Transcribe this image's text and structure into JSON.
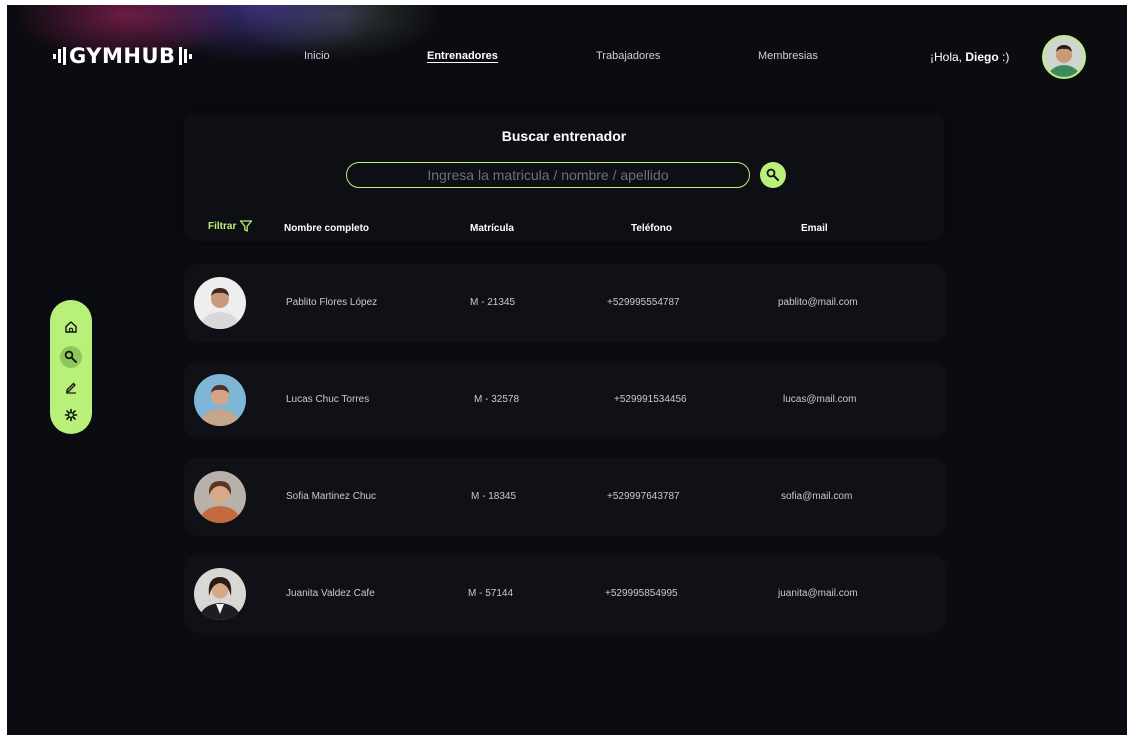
{
  "brand": {
    "logo_text": "GYMHUB",
    "accent": "#b8f07a",
    "background": "#0b0c11"
  },
  "nav": [
    {
      "label": "Inicio",
      "active": false
    },
    {
      "label": "Entrenadores",
      "active": true
    },
    {
      "label": "Trabajadores",
      "active": false
    },
    {
      "label": "Membresias",
      "active": false
    }
  ],
  "user": {
    "greeting": "¡Hola, ",
    "name": "Diego",
    "suffix": " :)"
  },
  "search": {
    "title": "Buscar entrenador",
    "placeholder": "Ingresa la matricula / nombre / apellido",
    "value": "",
    "icon": "search-icon"
  },
  "table": {
    "filter_label": "Filtrar",
    "columns": [
      "Nombre completo",
      "Matrícula",
      "Teléfono",
      "Email"
    ],
    "rows": [
      {
        "name": "Pablito Flores López",
        "matricula": "M - 21345",
        "telefono": "+529995554787",
        "email": "pablito@mail.com"
      },
      {
        "name": "Lucas Chuc Torres",
        "matricula": "M - 32578",
        "telefono": "+529991534456",
        "email": "lucas@mail.com"
      },
      {
        "name": "Sofia Martinez Chuc",
        "matricula": "M - 18345",
        "telefono": "+529997643787",
        "email": "sofia@mail.com"
      },
      {
        "name": "Juanita Valdez Cafe",
        "matricula": "M - 57144",
        "telefono": "+529995854995",
        "email": "juanita@mail.com"
      }
    ]
  },
  "dock": {
    "items": [
      {
        "icon": "home-icon",
        "active": false
      },
      {
        "icon": "search-icon",
        "active": true
      },
      {
        "icon": "edit-icon",
        "active": false
      },
      {
        "icon": "settings-icon",
        "active": false
      }
    ]
  }
}
